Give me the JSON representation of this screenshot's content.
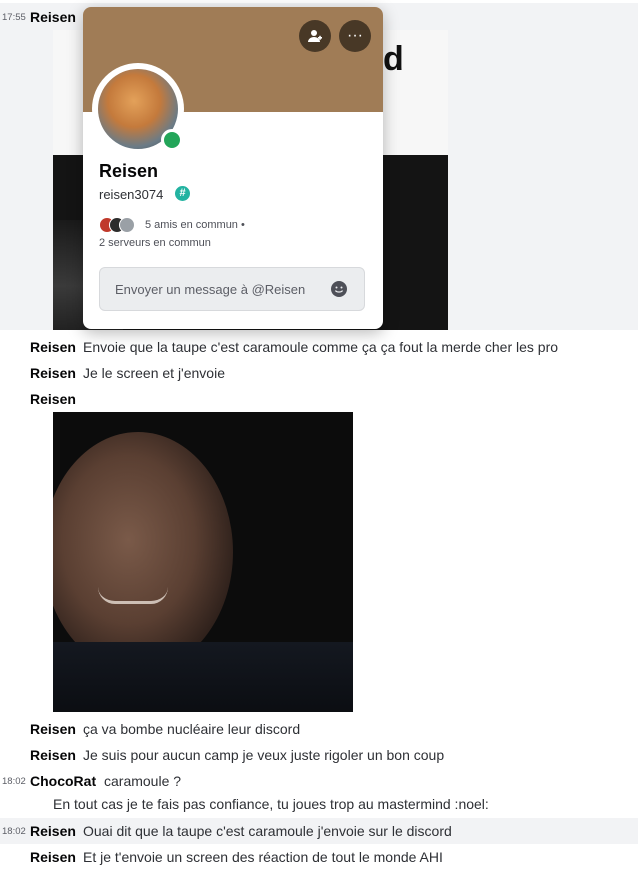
{
  "messages": [
    {
      "time": "17:55",
      "author": "Reisen",
      "text": ""
    },
    {
      "author": "Reisen",
      "text": "Envoie que la taupe c'est caramoule comme ça ça fout la merde cher les pro"
    },
    {
      "author": "Reisen",
      "text": "Je le screen et j'envoie"
    },
    {
      "author": "Reisen",
      "text": ""
    },
    {
      "author": "Reisen",
      "text": "ça va bombe nucléaire leur discord"
    },
    {
      "author": "Reisen",
      "text": "Je suis pour aucun camp je veux juste rigoler un bon coup"
    },
    {
      "time": "18:02",
      "author": "ChocoRat",
      "text": "caramoule ?"
    },
    {
      "text": "En tout cas je te fais pas confiance, tu joues trop au mastermind :noel:"
    },
    {
      "time": "18:02",
      "author": "Reisen",
      "text": "Ouai dit que la taupe c'est caramoule j'envoie sur le discord"
    },
    {
      "author": "Reisen",
      "text": "Et je t'envoie un screen des réaction de tout le monde AHI"
    }
  ],
  "image1": {
    "partial_text": "d"
  },
  "profile": {
    "display_name": "Reisen",
    "username": "reisen3074",
    "badge": "#",
    "status_color": "#23a559",
    "banner_color": "#a07c56",
    "mutual_friends": "5 amis en commun",
    "mutual_servers": "2 serveurs en commun",
    "separator": "•",
    "dm_placeholder": "Envoyer un message à @Reisen",
    "icons": {
      "add_friend": "person-add-icon",
      "more": "more-dots-icon",
      "emoji": "emoji-icon"
    },
    "more_glyph": "···"
  }
}
